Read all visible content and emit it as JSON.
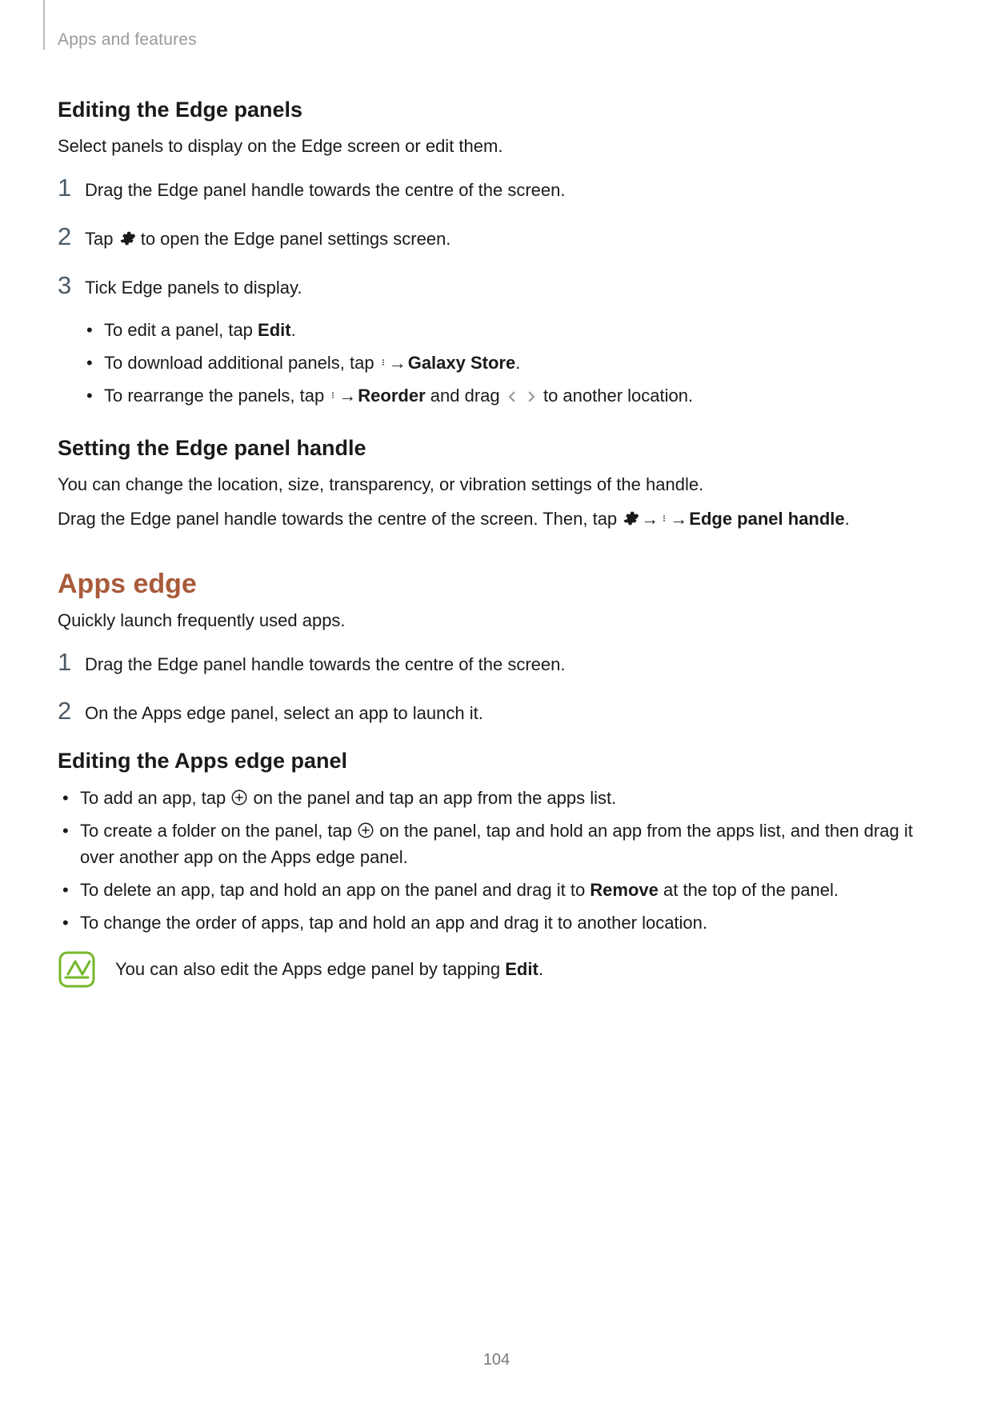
{
  "header": {
    "breadcrumb": "Apps and features"
  },
  "s1": {
    "title": "Editing the Edge panels",
    "intro": "Select panels to display on the Edge screen or edit them.",
    "steps": [
      {
        "num": "1",
        "text": "Drag the Edge panel handle towards the centre of the screen."
      },
      {
        "num": "2",
        "pre": "Tap ",
        "post": " to open the Edge panel settings screen."
      },
      {
        "num": "3",
        "text": "Tick Edge panels to display."
      }
    ],
    "sub": {
      "a_pre": "To edit a panel, tap ",
      "a_bold": "Edit",
      "a_post": ".",
      "b_pre": "To download additional panels, tap ",
      "b_arrow": " → ",
      "b_bold": "Galaxy Store",
      "b_post": ".",
      "c_pre": "To rearrange the panels, tap ",
      "c_arrow": " → ",
      "c_bold": "Reorder",
      "c_mid": " and drag ",
      "c_post": " to another location."
    }
  },
  "s2": {
    "title": "Setting the Edge panel handle",
    "p1": "You can change the location, size, transparency, or vibration settings of the handle.",
    "p2_pre": "Drag the Edge panel handle towards the centre of the screen. Then, tap ",
    "p2_arrow1": " → ",
    "p2_arrow2": " → ",
    "p2_bold": "Edge panel handle",
    "p2_post": "."
  },
  "s3": {
    "title": "Apps edge",
    "intro": "Quickly launch frequently used apps.",
    "steps": [
      {
        "num": "1",
        "text": "Drag the Edge panel handle towards the centre of the screen."
      },
      {
        "num": "2",
        "text": "On the Apps edge panel, select an app to launch it."
      }
    ]
  },
  "s4": {
    "title": "Editing the Apps edge panel",
    "items": {
      "a_pre": "To add an app, tap ",
      "a_post": " on the panel and tap an app from the apps list.",
      "b_pre": "To create a folder on the panel, tap ",
      "b_post": " on the panel, tap and hold an app from the apps list, and then drag it over another app on the Apps edge panel.",
      "c_pre": "To delete an app, tap and hold an app on the panel and drag it to ",
      "c_bold": "Remove",
      "c_post": " at the top of the panel.",
      "d": "To change the order of apps, tap and hold an app and drag it to another location."
    },
    "note_pre": "You can also edit the Apps edge panel by tapping ",
    "note_bold": "Edit",
    "note_post": "."
  },
  "pageNumber": "104"
}
